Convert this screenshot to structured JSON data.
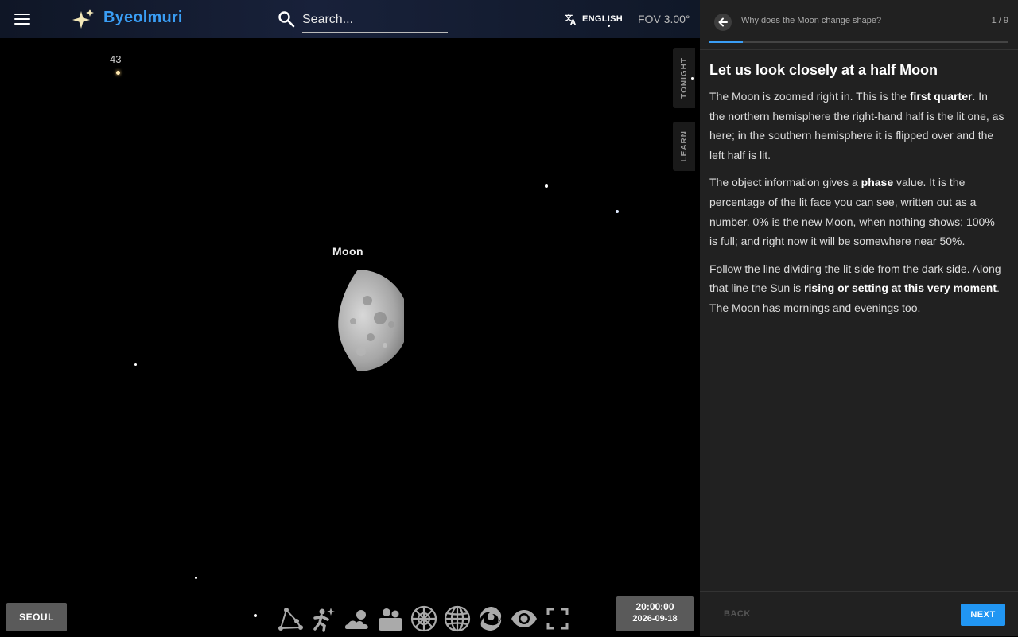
{
  "app": {
    "title": "Byeolmuri",
    "search_placeholder": "Search...",
    "language": "ENGLISH",
    "fov": "FOV 3.00°"
  },
  "side_tabs": [
    "TONIGHT",
    "LEARN"
  ],
  "sky": {
    "moon_label": "Moon",
    "star_label": "43",
    "location": "SEOUL",
    "time": "20:00:00",
    "date": "2026-09-18"
  },
  "toolbar_icons": [
    "constellation-lines-icon",
    "constellation-art-icon",
    "atmosphere-icon",
    "landscape-icon",
    "azimuthal-grid-icon",
    "equatorial-grid-icon",
    "deep-sky-icon",
    "night-mode-eye-icon",
    "fullscreen-icon"
  ],
  "tour": {
    "title": "Why does the Moon change shape?",
    "counter": "1 / 9",
    "progress": 0.111,
    "heading": "Let us look closely at a half Moon",
    "p1": {
      "a": "The Moon is zoomed right in. This is the ",
      "b": "first quarter",
      "c": ". In the northern hemisphere the right-hand half is the lit one, as here; in the southern hemisphere it is flipped over and the left half is lit."
    },
    "p2": {
      "a": "The object information gives a ",
      "b": "phase",
      "c": " value. It is the percentage of the lit face you can see, written out as a number. 0% is the new Moon, when nothing shows; 100% is full; and right now it will be somewhere near 50%."
    },
    "p3": {
      "a": "Follow the line dividing the lit side from the dark side. Along that line the Sun is ",
      "b": "rising or setting at this very moment",
      "c": ". The Moon has mornings and evenings too."
    },
    "back_label": "BACK",
    "next_label": "NEXT"
  }
}
